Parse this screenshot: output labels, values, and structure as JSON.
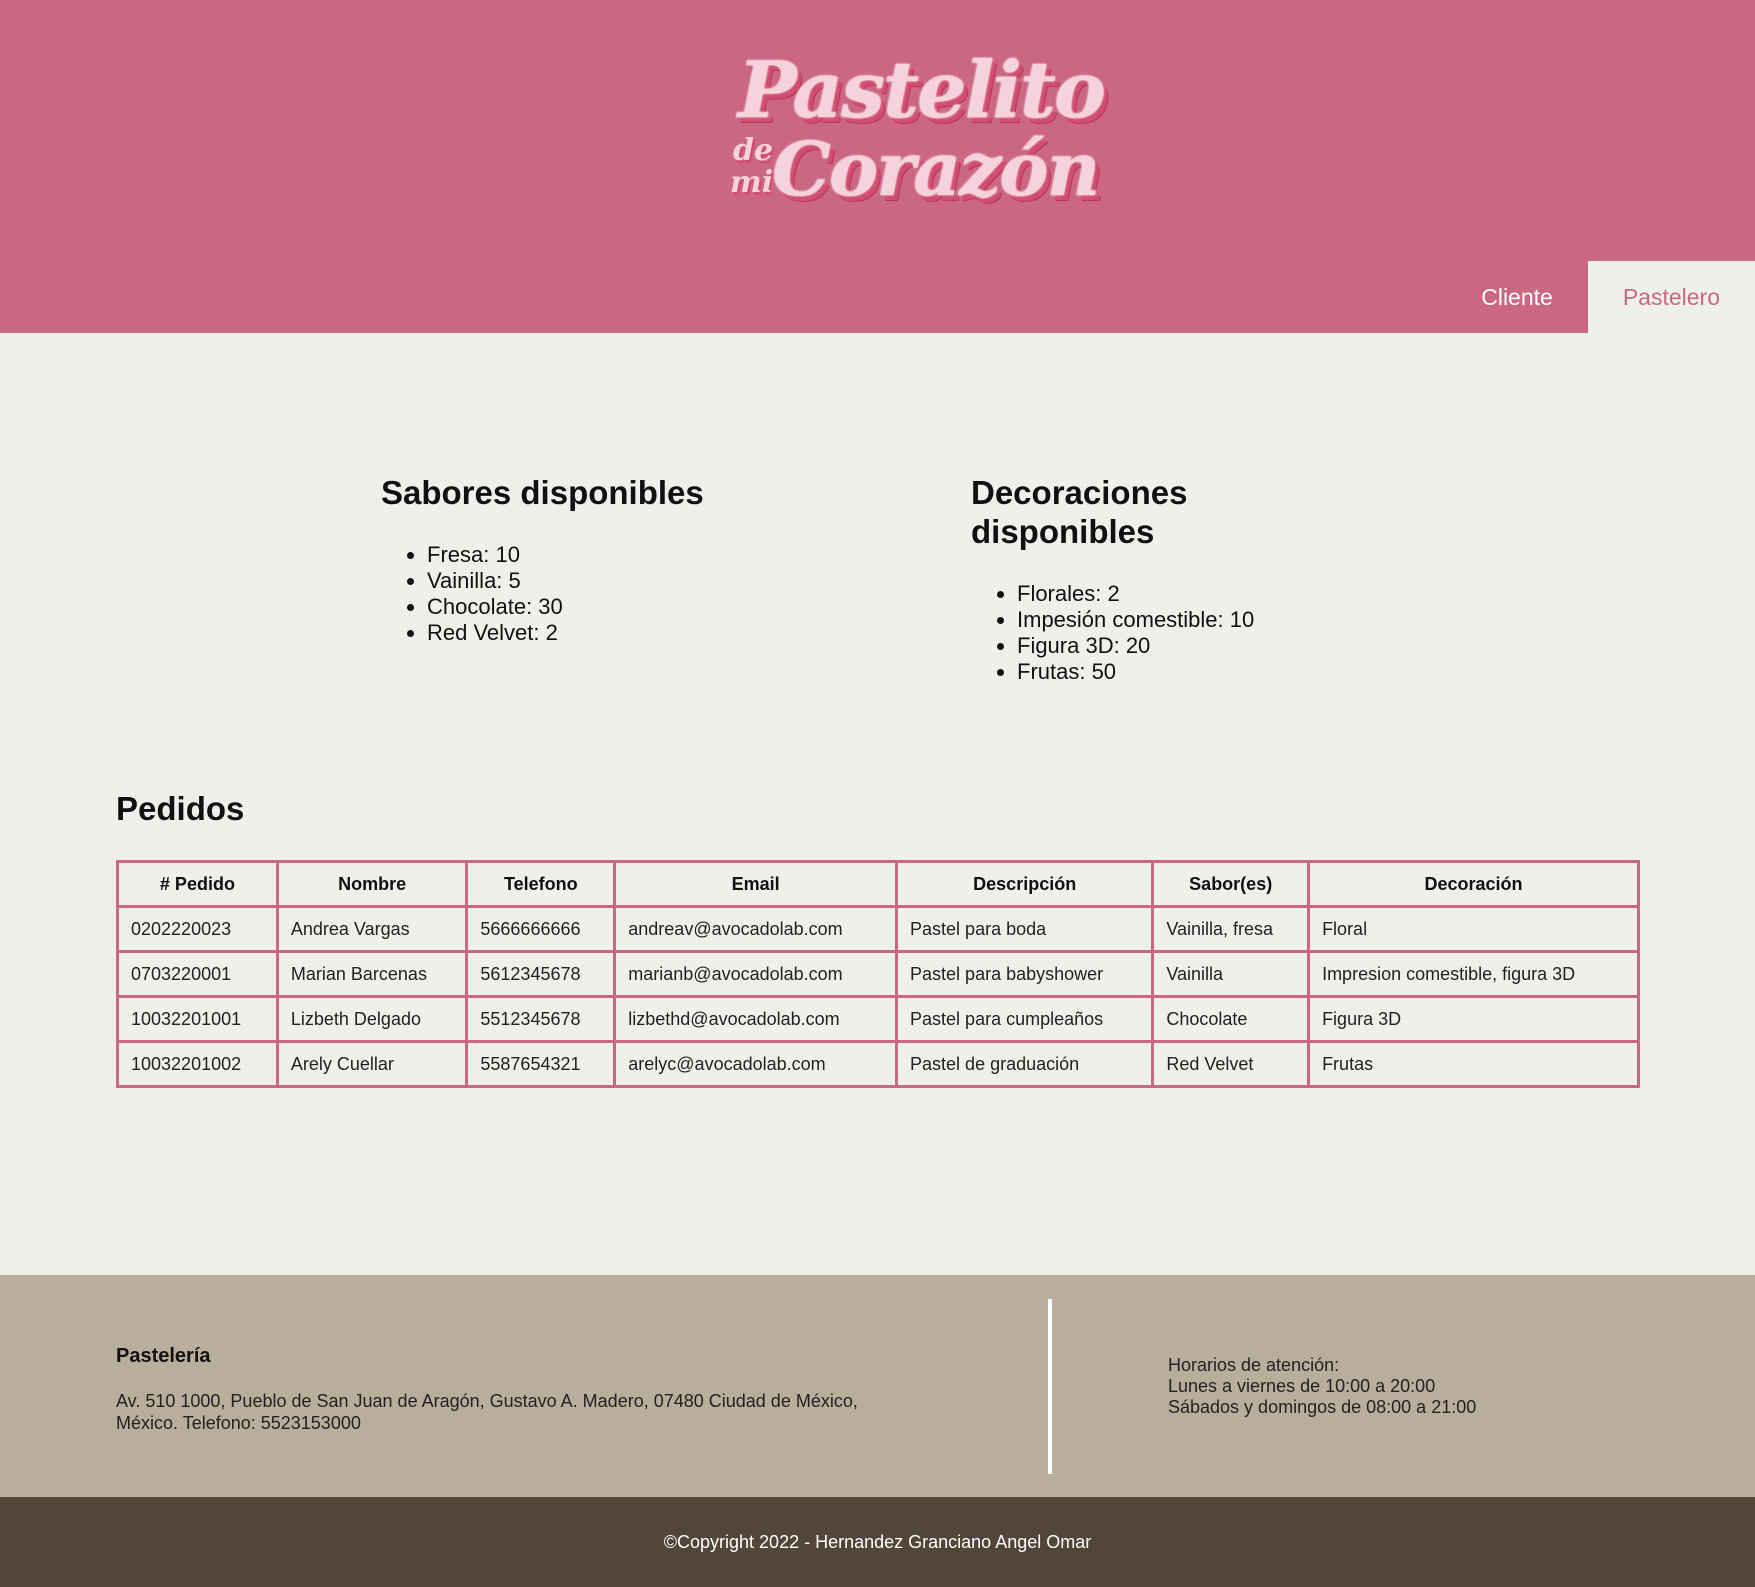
{
  "header": {
    "logo": {
      "line1": "Pastelito",
      "de": "de",
      "mi": "mi",
      "line2": "Corazón"
    },
    "nav": [
      {
        "label": "Cliente"
      },
      {
        "label": "Pastelero"
      }
    ],
    "colors": {
      "header_bg": "#cb6685",
      "page_bg": "#edf0eb"
    }
  },
  "sabores": {
    "title": "Sabores disponibles",
    "items": [
      "Fresa: 10",
      "Vainilla: 5",
      "Chocolate: 30",
      "Red Velvet: 2"
    ]
  },
  "decoraciones": {
    "title": "Decoraciones disponibles",
    "items": [
      "Florales: 2",
      "Impesión comestible: 10",
      "Figura 3D: 20",
      "Frutas: 50"
    ]
  },
  "pedidos": {
    "title": "Pedidos",
    "columns": [
      "# Pedido",
      "Nombre",
      "Telefono",
      "Email",
      "Descripción",
      "Sabor(es)",
      "Decoración"
    ],
    "rows": [
      [
        "0202220023",
        "Andrea Vargas",
        "5666666666",
        "andreav@avocadolab.com",
        "Pastel para boda",
        "Vainilla, fresa",
        "Floral"
      ],
      [
        "0703220001",
        "Marian Barcenas",
        "5612345678",
        "marianb@avocadolab.com",
        "Pastel para babyshower",
        "Vainilla",
        "Impresion comestible, figura 3D"
      ],
      [
        "10032201001",
        "Lizbeth Delgado",
        "5512345678",
        "lizbethd@avocadolab.com",
        "Pastel para cumpleaños",
        "Chocolate",
        "Figura 3D"
      ],
      [
        "10032201002",
        "Arely Cuellar",
        "5587654321",
        "arelyc@avocadolab.com",
        "Pastel de graduación",
        "Red Velvet",
        "Frutas"
      ]
    ]
  },
  "footer": {
    "title": "Pastelería",
    "address": "Av. 510 1000, Pueblo de San Juan de Aragón, Gustavo A. Madero, 07480 Ciudad de México, México. Telefono: 5523153000",
    "hours": [
      "Horarios de atención:",
      "Lunes a viernes de 10:00 a 20:00",
      "Sábados y domingos de 08:00 a 21:00"
    ],
    "copyright": "©Copyright 2022 - Hernandez Granciano Angel Omar",
    "colors": {
      "info_bg": "#b9ad9c",
      "bottom_bg": "#514637"
    }
  }
}
